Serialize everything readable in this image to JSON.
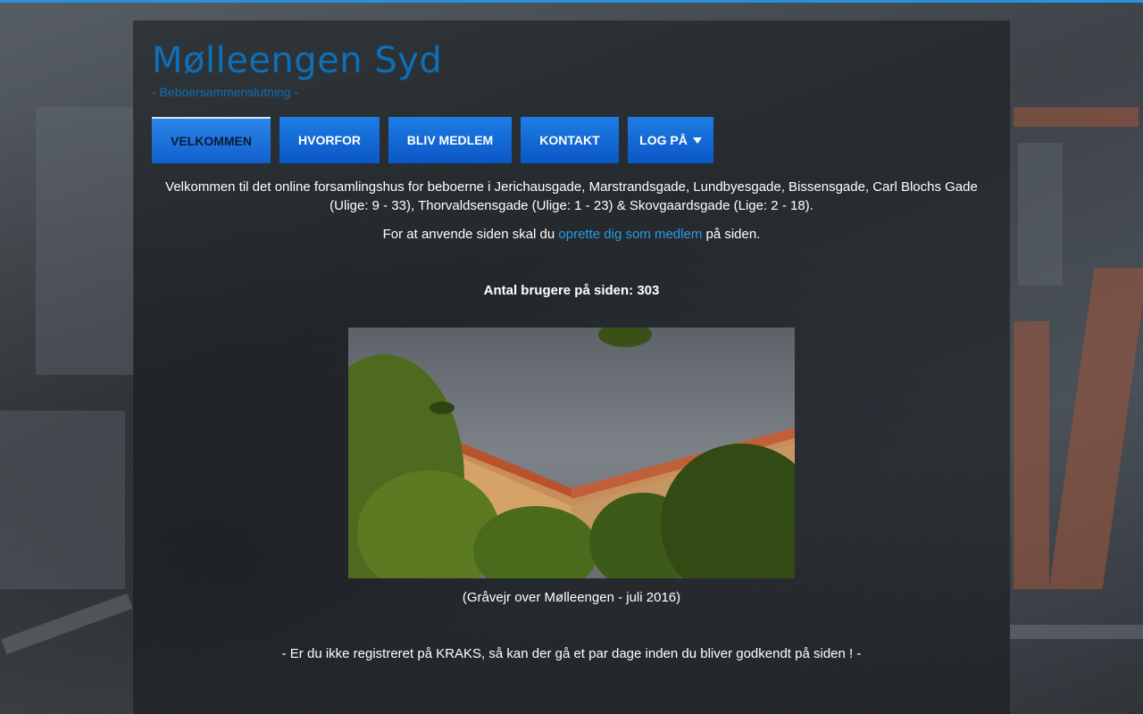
{
  "site": {
    "title": "Mølleengen Syd",
    "subtitle": "- Beboersammenslutning -"
  },
  "nav": {
    "items": [
      {
        "label": "VELKOMMEN",
        "active": true
      },
      {
        "label": "HVORFOR",
        "active": false
      },
      {
        "label": "BLIV MEDLEM",
        "active": false
      },
      {
        "label": "KONTAKT",
        "active": false
      },
      {
        "label": "LOG PÅ",
        "active": false,
        "has_dropdown": true
      }
    ]
  },
  "content": {
    "intro_line1": "Velkommen til det online forsamlingshus for beboerne i Jerichausgade, Marstrandsgade, Lundbyesgade, Bissensgade, Carl Blochs Gade",
    "intro_line2": "(Ulige: 9 - 33), Thorvaldsensgade (Ulige: 1 - 23) & Skovgaardsgade (Lige: 2 - 18).",
    "signup_prefix": "For at anvende siden skal du",
    "signup_link": "oprette dig som medlem",
    "signup_suffix": "på siden.",
    "user_count": "Antal brugere på siden: 303",
    "photo_caption": "(Gråvejr over Mølleengen - juli 2016)",
    "notice": "- Er du ikke registreret på KRAKS, så kan der gå et par dage inden du bliver godkendt på siden ! -"
  },
  "colors": {
    "accent": "#2b8fe0",
    "nav_button": "#0b57c4",
    "title": "#0e6fb8",
    "link": "#2b9ae8"
  }
}
